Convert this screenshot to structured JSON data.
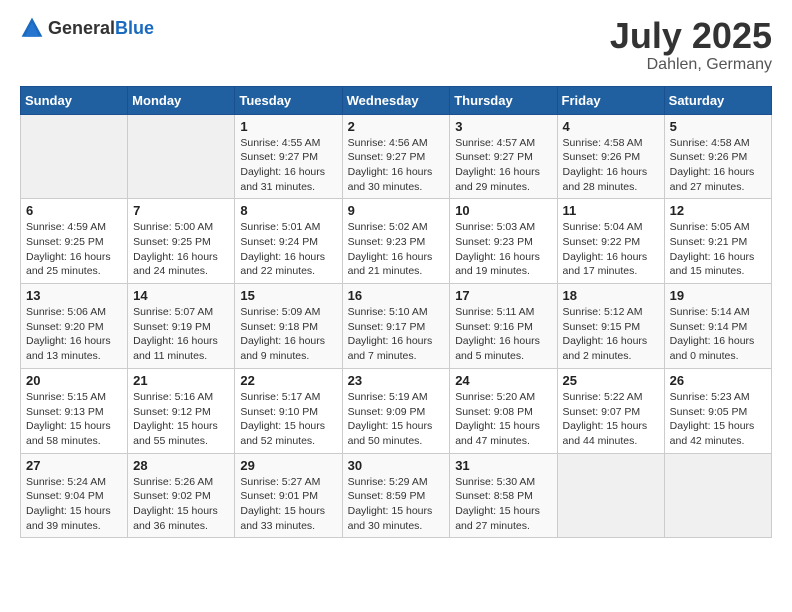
{
  "logo": {
    "text_general": "General",
    "text_blue": "Blue"
  },
  "title": "July 2025",
  "subtitle": "Dahlen, Germany",
  "header": {
    "days": [
      "Sunday",
      "Monday",
      "Tuesday",
      "Wednesday",
      "Thursday",
      "Friday",
      "Saturday"
    ]
  },
  "weeks": [
    [
      {
        "day": "",
        "sunrise": "",
        "sunset": "",
        "daylight": ""
      },
      {
        "day": "",
        "sunrise": "",
        "sunset": "",
        "daylight": ""
      },
      {
        "day": "1",
        "sunrise": "Sunrise: 4:55 AM",
        "sunset": "Sunset: 9:27 PM",
        "daylight": "Daylight: 16 hours and 31 minutes."
      },
      {
        "day": "2",
        "sunrise": "Sunrise: 4:56 AM",
        "sunset": "Sunset: 9:27 PM",
        "daylight": "Daylight: 16 hours and 30 minutes."
      },
      {
        "day": "3",
        "sunrise": "Sunrise: 4:57 AM",
        "sunset": "Sunset: 9:27 PM",
        "daylight": "Daylight: 16 hours and 29 minutes."
      },
      {
        "day": "4",
        "sunrise": "Sunrise: 4:58 AM",
        "sunset": "Sunset: 9:26 PM",
        "daylight": "Daylight: 16 hours and 28 minutes."
      },
      {
        "day": "5",
        "sunrise": "Sunrise: 4:58 AM",
        "sunset": "Sunset: 9:26 PM",
        "daylight": "Daylight: 16 hours and 27 minutes."
      }
    ],
    [
      {
        "day": "6",
        "sunrise": "Sunrise: 4:59 AM",
        "sunset": "Sunset: 9:25 PM",
        "daylight": "Daylight: 16 hours and 25 minutes."
      },
      {
        "day": "7",
        "sunrise": "Sunrise: 5:00 AM",
        "sunset": "Sunset: 9:25 PM",
        "daylight": "Daylight: 16 hours and 24 minutes."
      },
      {
        "day": "8",
        "sunrise": "Sunrise: 5:01 AM",
        "sunset": "Sunset: 9:24 PM",
        "daylight": "Daylight: 16 hours and 22 minutes."
      },
      {
        "day": "9",
        "sunrise": "Sunrise: 5:02 AM",
        "sunset": "Sunset: 9:23 PM",
        "daylight": "Daylight: 16 hours and 21 minutes."
      },
      {
        "day": "10",
        "sunrise": "Sunrise: 5:03 AM",
        "sunset": "Sunset: 9:23 PM",
        "daylight": "Daylight: 16 hours and 19 minutes."
      },
      {
        "day": "11",
        "sunrise": "Sunrise: 5:04 AM",
        "sunset": "Sunset: 9:22 PM",
        "daylight": "Daylight: 16 hours and 17 minutes."
      },
      {
        "day": "12",
        "sunrise": "Sunrise: 5:05 AM",
        "sunset": "Sunset: 9:21 PM",
        "daylight": "Daylight: 16 hours and 15 minutes."
      }
    ],
    [
      {
        "day": "13",
        "sunrise": "Sunrise: 5:06 AM",
        "sunset": "Sunset: 9:20 PM",
        "daylight": "Daylight: 16 hours and 13 minutes."
      },
      {
        "day": "14",
        "sunrise": "Sunrise: 5:07 AM",
        "sunset": "Sunset: 9:19 PM",
        "daylight": "Daylight: 16 hours and 11 minutes."
      },
      {
        "day": "15",
        "sunrise": "Sunrise: 5:09 AM",
        "sunset": "Sunset: 9:18 PM",
        "daylight": "Daylight: 16 hours and 9 minutes."
      },
      {
        "day": "16",
        "sunrise": "Sunrise: 5:10 AM",
        "sunset": "Sunset: 9:17 PM",
        "daylight": "Daylight: 16 hours and 7 minutes."
      },
      {
        "day": "17",
        "sunrise": "Sunrise: 5:11 AM",
        "sunset": "Sunset: 9:16 PM",
        "daylight": "Daylight: 16 hours and 5 minutes."
      },
      {
        "day": "18",
        "sunrise": "Sunrise: 5:12 AM",
        "sunset": "Sunset: 9:15 PM",
        "daylight": "Daylight: 16 hours and 2 minutes."
      },
      {
        "day": "19",
        "sunrise": "Sunrise: 5:14 AM",
        "sunset": "Sunset: 9:14 PM",
        "daylight": "Daylight: 16 hours and 0 minutes."
      }
    ],
    [
      {
        "day": "20",
        "sunrise": "Sunrise: 5:15 AM",
        "sunset": "Sunset: 9:13 PM",
        "daylight": "Daylight: 15 hours and 58 minutes."
      },
      {
        "day": "21",
        "sunrise": "Sunrise: 5:16 AM",
        "sunset": "Sunset: 9:12 PM",
        "daylight": "Daylight: 15 hours and 55 minutes."
      },
      {
        "day": "22",
        "sunrise": "Sunrise: 5:17 AM",
        "sunset": "Sunset: 9:10 PM",
        "daylight": "Daylight: 15 hours and 52 minutes."
      },
      {
        "day": "23",
        "sunrise": "Sunrise: 5:19 AM",
        "sunset": "Sunset: 9:09 PM",
        "daylight": "Daylight: 15 hours and 50 minutes."
      },
      {
        "day": "24",
        "sunrise": "Sunrise: 5:20 AM",
        "sunset": "Sunset: 9:08 PM",
        "daylight": "Daylight: 15 hours and 47 minutes."
      },
      {
        "day": "25",
        "sunrise": "Sunrise: 5:22 AM",
        "sunset": "Sunset: 9:07 PM",
        "daylight": "Daylight: 15 hours and 44 minutes."
      },
      {
        "day": "26",
        "sunrise": "Sunrise: 5:23 AM",
        "sunset": "Sunset: 9:05 PM",
        "daylight": "Daylight: 15 hours and 42 minutes."
      }
    ],
    [
      {
        "day": "27",
        "sunrise": "Sunrise: 5:24 AM",
        "sunset": "Sunset: 9:04 PM",
        "daylight": "Daylight: 15 hours and 39 minutes."
      },
      {
        "day": "28",
        "sunrise": "Sunrise: 5:26 AM",
        "sunset": "Sunset: 9:02 PM",
        "daylight": "Daylight: 15 hours and 36 minutes."
      },
      {
        "day": "29",
        "sunrise": "Sunrise: 5:27 AM",
        "sunset": "Sunset: 9:01 PM",
        "daylight": "Daylight: 15 hours and 33 minutes."
      },
      {
        "day": "30",
        "sunrise": "Sunrise: 5:29 AM",
        "sunset": "Sunset: 8:59 PM",
        "daylight": "Daylight: 15 hours and 30 minutes."
      },
      {
        "day": "31",
        "sunrise": "Sunrise: 5:30 AM",
        "sunset": "Sunset: 8:58 PM",
        "daylight": "Daylight: 15 hours and 27 minutes."
      },
      {
        "day": "",
        "sunrise": "",
        "sunset": "",
        "daylight": ""
      },
      {
        "day": "",
        "sunrise": "",
        "sunset": "",
        "daylight": ""
      }
    ]
  ]
}
